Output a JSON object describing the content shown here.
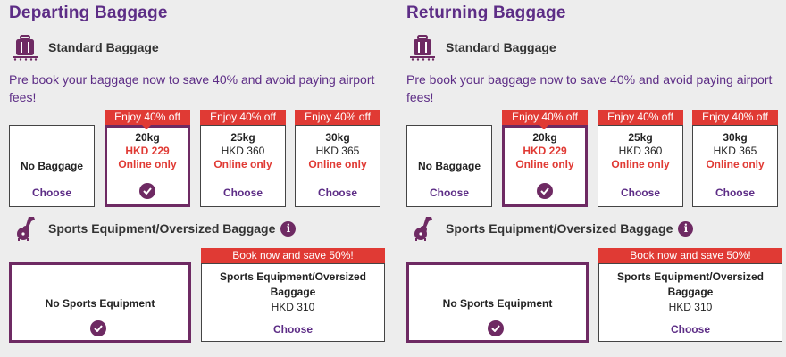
{
  "colors": {
    "brand_purple": "#5d2d86",
    "selected_border": "#6e2a63",
    "promo_red": "#e03a34",
    "background": "#ededed"
  },
  "columns": [
    {
      "title": "Departing Baggage",
      "standard_label": "Standard Baggage",
      "standard_icon": "luggage-icon",
      "promo_text": "Pre book your baggage now to save 40% and avoid paying airport fees!",
      "options": [
        {
          "label": "No Baggage",
          "choose": "Choose"
        },
        {
          "ribbon": "Enjoy 40% off",
          "weight": "20kg",
          "price": "HKD 229",
          "online": "Online only",
          "selected": true
        },
        {
          "ribbon": "Enjoy 40% off",
          "weight": "25kg",
          "price": "HKD 360",
          "online": "Online only",
          "choose": "Choose"
        },
        {
          "ribbon": "Enjoy 40% off",
          "weight": "30kg",
          "price": "HKD 365",
          "online": "Online only",
          "choose": "Choose"
        }
      ],
      "sports_label": "Sports Equipment/Oversized Baggage",
      "sports_icon": "guitar-icon",
      "info_icon": "info-icon",
      "info_glyph": "i",
      "sports_none": "No Sports Equipment",
      "sports_option": {
        "ribbon": "Book now and save 50%!",
        "name_line1": "Sports Equipment/Oversized",
        "name_line2": "Baggage",
        "price": "HKD 310",
        "choose": "Choose"
      }
    },
    {
      "title": "Returning Baggage",
      "standard_label": "Standard Baggage",
      "standard_icon": "luggage-icon",
      "promo_text": "Pre book your baggage now to save 40% and avoid paying airport fees!",
      "options": [
        {
          "label": "No Baggage",
          "choose": "Choose"
        },
        {
          "ribbon": "Enjoy 40% off",
          "weight": "20kg",
          "price": "HKD 229",
          "online": "Online only",
          "selected": true
        },
        {
          "ribbon": "Enjoy 40% off",
          "weight": "25kg",
          "price": "HKD 360",
          "online": "Online only",
          "choose": "Choose"
        },
        {
          "ribbon": "Enjoy 40% off",
          "weight": "30kg",
          "price": "HKD 365",
          "online": "Online only",
          "choose": "Choose"
        }
      ],
      "sports_label": "Sports Equipment/Oversized Baggage",
      "sports_icon": "guitar-icon",
      "info_icon": "info-icon",
      "info_glyph": "i",
      "sports_none": "No Sports Equipment",
      "sports_option": {
        "ribbon": "Book now and save 50%!",
        "name_line1": "Sports Equipment/Oversized",
        "name_line2": "Baggage",
        "price": "HKD 310",
        "choose": "Choose"
      }
    }
  ]
}
